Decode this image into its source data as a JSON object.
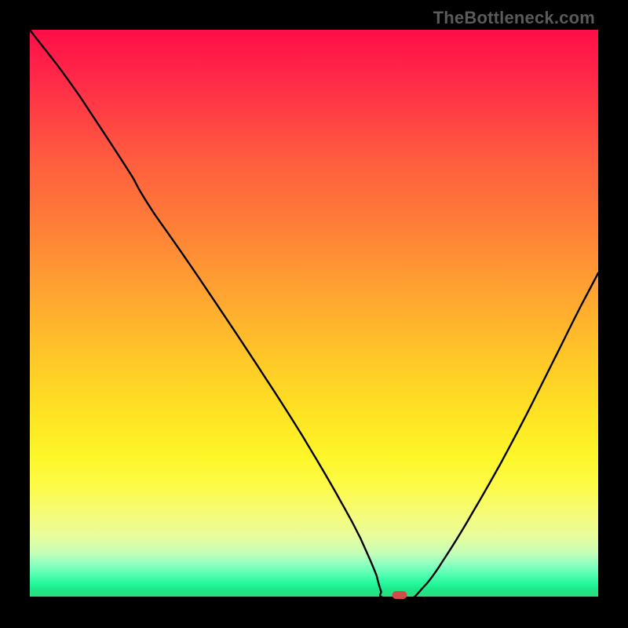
{
  "attribution": "TheBottleneck.com",
  "chart_data": {
    "type": "line",
    "title": "",
    "xlabel": "",
    "ylabel": "",
    "xlim": [
      0,
      1
    ],
    "ylim": [
      0,
      1
    ],
    "series": [
      {
        "name": "bottleneck-curve",
        "points": [
          {
            "x": 0.0,
            "y": 1.0
          },
          {
            "x": 0.09,
            "y": 0.88
          },
          {
            "x": 0.18,
            "y": 0.742
          },
          {
            "x": 0.22,
            "y": 0.675
          },
          {
            "x": 0.3,
            "y": 0.56
          },
          {
            "x": 0.4,
            "y": 0.41
          },
          {
            "x": 0.48,
            "y": 0.285
          },
          {
            "x": 0.54,
            "y": 0.183
          },
          {
            "x": 0.582,
            "y": 0.105
          },
          {
            "x": 0.61,
            "y": 0.04
          },
          {
            "x": 0.618,
            "y": 0.012
          },
          {
            "x": 0.625,
            "y": 0.0
          },
          {
            "x": 0.672,
            "y": 0.0
          },
          {
            "x": 0.686,
            "y": 0.012
          },
          {
            "x": 0.72,
            "y": 0.055
          },
          {
            "x": 0.77,
            "y": 0.135
          },
          {
            "x": 0.83,
            "y": 0.24
          },
          {
            "x": 0.88,
            "y": 0.335
          },
          {
            "x": 0.93,
            "y": 0.435
          },
          {
            "x": 0.97,
            "y": 0.515
          },
          {
            "x": 1.0,
            "y": 0.572
          }
        ]
      }
    ],
    "marker": {
      "x": 0.65,
      "y": 0.0
    },
    "gradient_stops": [
      {
        "pos": 0.0,
        "color": "#ff0e48"
      },
      {
        "pos": 0.5,
        "color": "#ffb02e"
      },
      {
        "pos": 0.78,
        "color": "#fdfb46"
      },
      {
        "pos": 1.0,
        "color": "#2ade7a"
      }
    ]
  }
}
